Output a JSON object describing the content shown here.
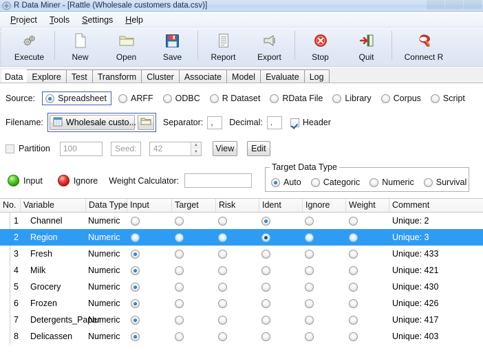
{
  "window": {
    "title": "R Data Miner - [Rattle (Wholesale customers data.csv)]",
    "icon": "rattle-app-icon"
  },
  "menubar": {
    "items": [
      {
        "label": "Project",
        "mnemonic": "P"
      },
      {
        "label": "Tools",
        "mnemonic": "T"
      },
      {
        "label": "Settings",
        "mnemonic": "S"
      },
      {
        "label": "Help",
        "mnemonic": "H"
      }
    ]
  },
  "toolbar": {
    "buttons": [
      {
        "label": "Execute",
        "icon": "gears-icon"
      },
      {
        "label": "New",
        "icon": "new-page-icon"
      },
      {
        "label": "Open",
        "icon": "open-folder-icon"
      },
      {
        "label": "Save",
        "icon": "floppy-disk-icon"
      },
      {
        "label": "Report",
        "icon": "report-document-icon"
      },
      {
        "label": "Export",
        "icon": "export-arrow-icon"
      },
      {
        "label": "Stop",
        "icon": "stop-sign-icon"
      },
      {
        "label": "Quit",
        "icon": "quit-door-icon"
      },
      {
        "label": "Connect R",
        "icon": "r-logo-icon"
      }
    ]
  },
  "tabs": {
    "items": [
      "Data",
      "Explore",
      "Test",
      "Transform",
      "Cluster",
      "Associate",
      "Model",
      "Evaluate",
      "Log"
    ],
    "active": "Data"
  },
  "source": {
    "label": "Source:",
    "options": [
      "Spreadsheet",
      "ARFF",
      "ODBC",
      "R Dataset",
      "RData File",
      "Library",
      "Corpus",
      "Script"
    ],
    "selected": "Spreadsheet"
  },
  "filename_row": {
    "label": "Filename:",
    "value": "Wholesale custo...",
    "file_icon": "spreadsheet-file-icon",
    "browse_icon": "folder-icon",
    "separator_label": "Separator:",
    "separator_value": ",",
    "decimal_label": "Decimal:",
    "decimal_value": ".",
    "header_label": "Header",
    "header_checked": true
  },
  "partition_row": {
    "partition_label": "Partition",
    "partition_checked": false,
    "partition_value": "100",
    "seed_label": "Seed:",
    "seed_value": "42",
    "view_button": "View",
    "edit_button": "Edit"
  },
  "roles_row": {
    "input_label": "Input",
    "ignore_label": "Ignore",
    "weight_label": "Weight Calculator:",
    "weight_value": ""
  },
  "target_data_type": {
    "legend": "Target Data Type",
    "options": [
      "Auto",
      "Categoric",
      "Numeric",
      "Survival"
    ],
    "selected": "Auto"
  },
  "variables_table": {
    "columns": [
      "No.",
      "Variable",
      "Data Type",
      "Input",
      "Target",
      "Risk",
      "Ident",
      "Ignore",
      "Weight",
      "Comment"
    ],
    "rows": [
      {
        "no": "1",
        "variable": "Channel",
        "datatype": "Numeric",
        "input": false,
        "target": false,
        "risk": false,
        "ident": true,
        "ignore": false,
        "weight": false,
        "comment": "Unique: 2",
        "selected": false
      },
      {
        "no": "2",
        "variable": "Region",
        "datatype": "Numeric",
        "input": false,
        "target": false,
        "risk": false,
        "ident": true,
        "ignore": false,
        "weight": false,
        "comment": "Unique: 3",
        "selected": true
      },
      {
        "no": "3",
        "variable": "Fresh",
        "datatype": "Numeric",
        "input": true,
        "target": false,
        "risk": false,
        "ident": false,
        "ignore": false,
        "weight": false,
        "comment": "Unique: 433",
        "selected": false
      },
      {
        "no": "4",
        "variable": "Milk",
        "datatype": "Numeric",
        "input": true,
        "target": false,
        "risk": false,
        "ident": false,
        "ignore": false,
        "weight": false,
        "comment": "Unique: 421",
        "selected": false
      },
      {
        "no": "5",
        "variable": "Grocery",
        "datatype": "Numeric",
        "input": true,
        "target": false,
        "risk": false,
        "ident": false,
        "ignore": false,
        "weight": false,
        "comment": "Unique: 430",
        "selected": false
      },
      {
        "no": "6",
        "variable": "Frozen",
        "datatype": "Numeric",
        "input": true,
        "target": false,
        "risk": false,
        "ident": false,
        "ignore": false,
        "weight": false,
        "comment": "Unique: 426",
        "selected": false
      },
      {
        "no": "7",
        "variable": "Detergents_Paper",
        "datatype": "Numeric",
        "input": true,
        "target": false,
        "risk": false,
        "ident": false,
        "ignore": false,
        "weight": false,
        "comment": "Unique: 417",
        "selected": false
      },
      {
        "no": "8",
        "variable": "Delicassen",
        "datatype": "Numeric",
        "input": true,
        "target": false,
        "risk": false,
        "ident": false,
        "ignore": false,
        "weight": false,
        "comment": "Unique: 403",
        "selected": false
      }
    ]
  },
  "colors": {
    "selection": "#2f9cf4",
    "focus_border": "#3b5fc0",
    "input_green": "#5fce2e",
    "ignore_red": "#e8453a"
  }
}
